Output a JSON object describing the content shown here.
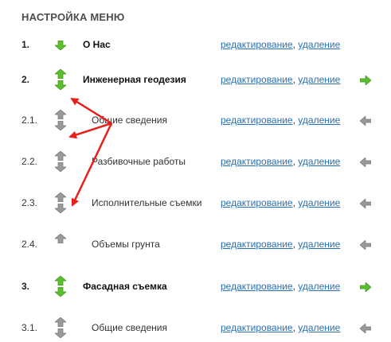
{
  "page": {
    "title": "НАСТРОЙКА МЕНЮ"
  },
  "actions": {
    "edit": "редактирование",
    "separator": ",",
    "delete": "удаление"
  },
  "colors": {
    "arrow_active": "#5cbf2e",
    "arrow_inactive": "#9a9a9a",
    "link": "#2a6fb2",
    "annotation": "#e8201c"
  },
  "menu": {
    "rows": [
      {
        "num": "1.",
        "label": "О Нас",
        "level": "top",
        "up": null,
        "down": "green",
        "side": "none"
      },
      {
        "num": "2.",
        "label": "Инженерная геодезия",
        "level": "top",
        "up": "green",
        "down": "green",
        "side": "green-right"
      },
      {
        "num": "2.1.",
        "label": "Общие сведения",
        "level": "sub",
        "up": "gray",
        "down": "gray",
        "side": "gray-left"
      },
      {
        "num": "2.2.",
        "label": "Разбивочные работы",
        "level": "sub",
        "up": "gray",
        "down": "gray",
        "side": "gray-left"
      },
      {
        "num": "2.3.",
        "label": "Исполнительные съемки",
        "level": "sub",
        "up": "gray",
        "down": "gray",
        "side": "gray-left"
      },
      {
        "num": "2.4.",
        "label": "Объемы грунта",
        "level": "sub",
        "up": "gray",
        "down": null,
        "side": "gray-left"
      },
      {
        "num": "3.",
        "label": "Фасадная съемка",
        "level": "top",
        "up": "green",
        "down": "green",
        "side": "green-right"
      },
      {
        "num": "3.1.",
        "label": "Общие сведения",
        "level": "sub",
        "up": "gray",
        "down": "gray",
        "side": "gray-left"
      }
    ]
  }
}
